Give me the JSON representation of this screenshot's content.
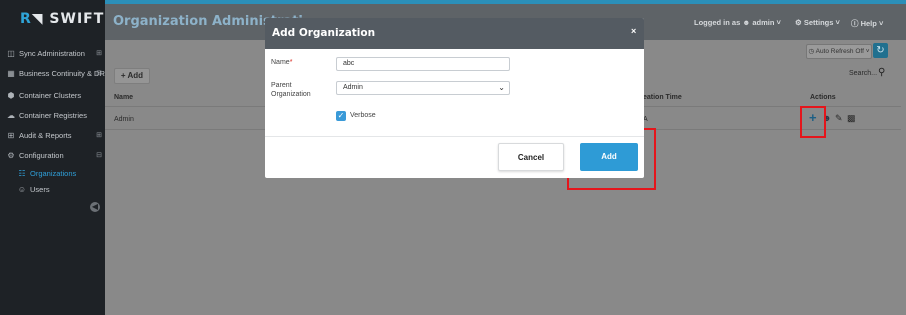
{
  "brand": {
    "prefix": "R",
    "name": "SWIFT"
  },
  "sidebar": {
    "items": [
      {
        "label": "Sync Administration",
        "icon": "sync-icon",
        "chevron": "⊞"
      },
      {
        "label": "Business Continuity & DR",
        "icon": "server-icon",
        "chevron": "⊞"
      },
      {
        "label": "Container Clusters",
        "icon": "cube-icon",
        "chevron": ""
      },
      {
        "label": "Container Registries",
        "icon": "cloud-icon",
        "chevron": ""
      },
      {
        "label": "Audit & Reports",
        "icon": "table-icon",
        "chevron": "⊞"
      },
      {
        "label": "Configuration",
        "icon": "cogs-icon",
        "chevron": "⊟"
      },
      {
        "label": "Organizations",
        "icon": "sitemap-icon",
        "chevron": ""
      },
      {
        "label": "Users",
        "icon": "users-icon",
        "chevron": ""
      }
    ]
  },
  "header": {
    "title": "Organization Administrati",
    "logged_in_prefix": "Logged in as",
    "user": "admin",
    "settings": "Settings",
    "help": "Help"
  },
  "toolbar": {
    "add_label": "+ Add",
    "auto_refresh": "Auto Refresh Off",
    "search_label": "Search..."
  },
  "table": {
    "columns": {
      "name": "Name",
      "creation_time": "eation Time",
      "actions": "Actions"
    },
    "rows": [
      {
        "name": "Admin",
        "creation_time": "A"
      }
    ]
  },
  "modal": {
    "title": "Add Organization",
    "close": "×",
    "name_label": "Name",
    "name_required": "*",
    "name_value": "abc",
    "parent_label_1": "Parent",
    "parent_label_2": "Organization",
    "parent_value": "Admin",
    "verbose_label": "Verbose",
    "verbose_checked": true,
    "cancel_label": "Cancel",
    "add_label": "Add"
  },
  "colors": {
    "accent": "#2e9bd6",
    "sidebar": "#1e2226",
    "highlight": "#e5151b"
  }
}
